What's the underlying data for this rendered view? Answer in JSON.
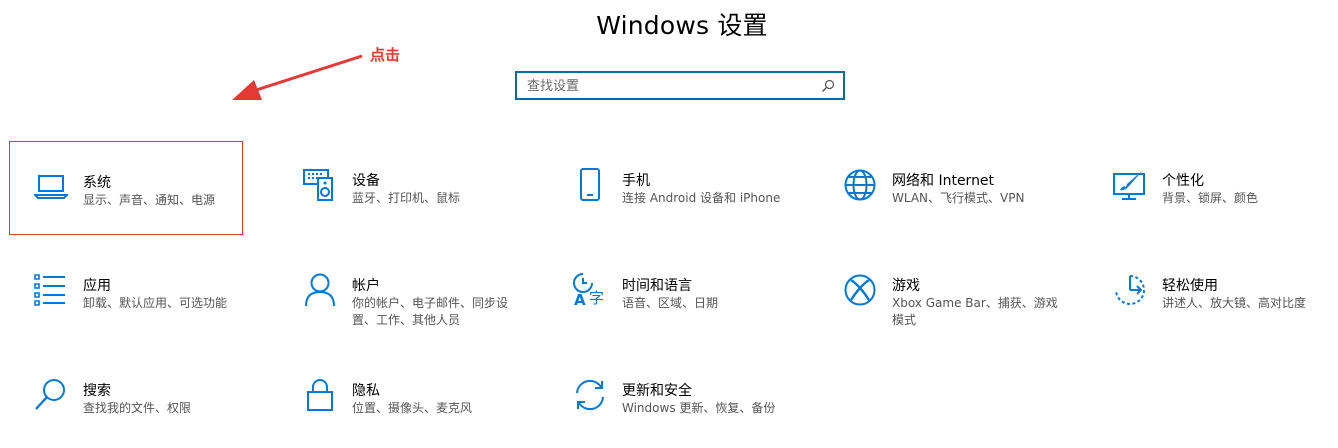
{
  "header": {
    "title": "Windows 设置"
  },
  "search": {
    "placeholder": "查找设置"
  },
  "annotation": {
    "label": "点击",
    "color": "#e53935"
  },
  "accent_color": "#0078d7",
  "tiles": [
    {
      "title": "系统",
      "desc": "显示、声音、通知、电源",
      "icon": "laptop-icon"
    },
    {
      "title": "设备",
      "desc": "蓝牙、打印机、鼠标",
      "icon": "keyboard-speaker-icon"
    },
    {
      "title": "手机",
      "desc": "连接 Android 设备和 iPhone",
      "icon": "phone-icon"
    },
    {
      "title": "网络和 Internet",
      "desc": "WLAN、飞行模式、VPN",
      "icon": "globe-icon"
    },
    {
      "title": "个性化",
      "desc": "背景、锁屏、颜色",
      "icon": "paint-brush-icon"
    },
    {
      "title": "应用",
      "desc": "卸载、默认应用、可选功能",
      "icon": "apps-list-icon"
    },
    {
      "title": "帐户",
      "desc": "你的帐户、电子邮件、同步设置、工作、其他人员",
      "icon": "person-icon"
    },
    {
      "title": "时间和语言",
      "desc": "语音、区域、日期",
      "icon": "time-language-icon"
    },
    {
      "title": "游戏",
      "desc": "Xbox Game Bar、捕获、游戏模式",
      "icon": "xbox-icon"
    },
    {
      "title": "轻松使用",
      "desc": "讲述人、放大镜、高对比度",
      "icon": "ease-of-access-icon"
    },
    {
      "title": "搜索",
      "desc": "查找我的文件、权限",
      "icon": "search-icon"
    },
    {
      "title": "隐私",
      "desc": "位置、摄像头、麦克风",
      "icon": "lock-icon"
    },
    {
      "title": "更新和安全",
      "desc": "Windows 更新、恢复、备份",
      "icon": "sync-icon"
    }
  ]
}
